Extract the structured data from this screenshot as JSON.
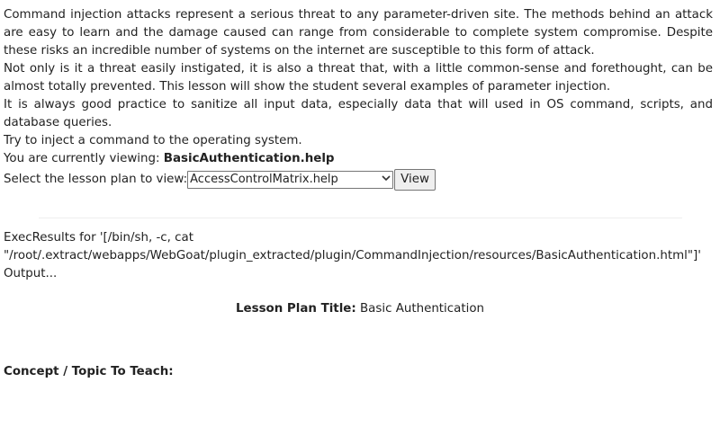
{
  "intro": {
    "paragraph1": "Command  injection attacks represent a serious threat to any parameter-driven site. The methods behind an attack are easy to learn and the damage caused can range from considerable to complete system compromise. Despite these risks an incredible number of systems on the internet are susceptible to this form of attack.",
    "paragraph2": "Not only is it a threat easily instigated, it is also a threat that, with a little common-sense and forethought, can be almost totally prevented. This lesson will show the student several examples of parameter injection.",
    "paragraph3": "It is always good practice to sanitize all input data, especially data that will used in OS command, scripts, and database queries.",
    "paragraph4": "Try to inject a command to the operating system."
  },
  "viewing": {
    "prefix": "You are currently viewing: ",
    "value": "BasicAuthentication.help"
  },
  "lesson_select": {
    "label": "Select the lesson plan to view:",
    "selected": "AccessControlMatrix.help",
    "button_label": "View"
  },
  "exec": {
    "line1": "ExecResults for '[/bin/sh, -c, cat",
    "line2": "\"/root/.extract/webapps/WebGoat/plugin_extracted/plugin/CommandInjection/resources/BasicAuthentication.html\"]'",
    "line3": "Output..."
  },
  "lesson_title": {
    "label": "Lesson Plan Title:",
    "value": " Basic Authentication"
  },
  "concept": {
    "label": "Concept / Topic To Teach:"
  },
  "icons": {
    "dropdown": "chevron-down-icon"
  }
}
